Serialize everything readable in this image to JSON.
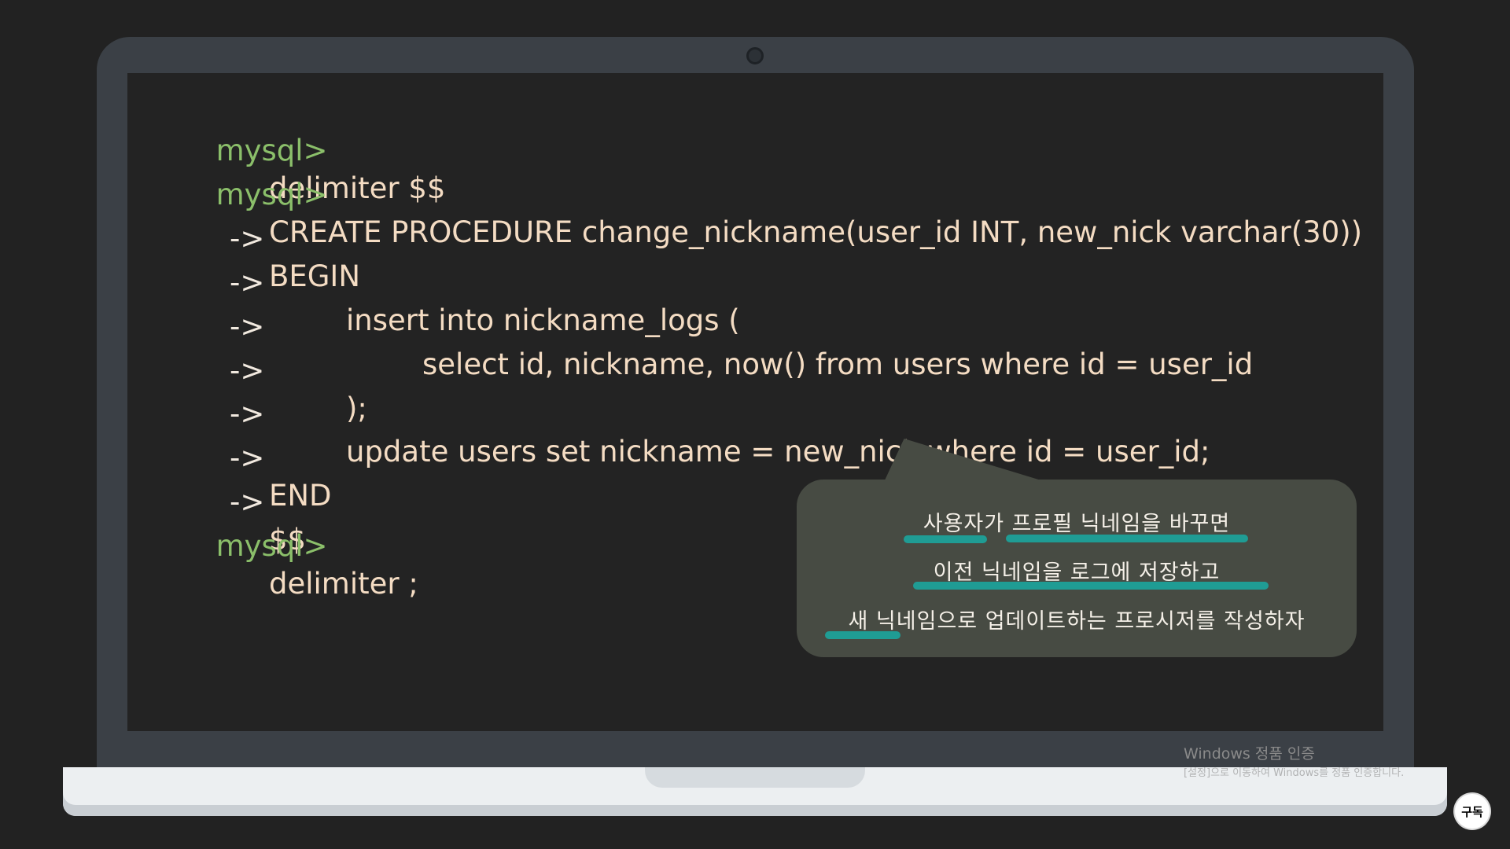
{
  "code": {
    "prompt": "mysql>",
    "arrow": "->",
    "lines": [
      "delimiter $$",
      "CREATE PROCEDURE change_nickname(user_id INT, new_nick varchar(30))",
      "BEGIN",
      "insert into nickname_logs (",
      "select id, nickname, now() from users where id = user_id",
      ");",
      "update users set nickname = new_nick where id = user_id;",
      "END",
      "$$",
      "delimiter ;"
    ]
  },
  "bubble": {
    "lines": [
      "사용자가 프로필 닉네임을 바꾸면",
      "이전 닉네임을 로그에 저장하고",
      "새 닉네임으로 업데이트하는 프로시저를 작성하자"
    ],
    "accent_color": "#1f9c94"
  },
  "watermark": {
    "title": "Windows 정품 인증",
    "subtitle": "[설정]으로 이동하여 Windows를 정품 인증합니다."
  },
  "subscribe": {
    "label": "구독"
  },
  "colors": {
    "background": "#222222",
    "prompt": "#8bbf6a",
    "code_text": "#f4dcc3",
    "bezel": "#3b4046"
  }
}
